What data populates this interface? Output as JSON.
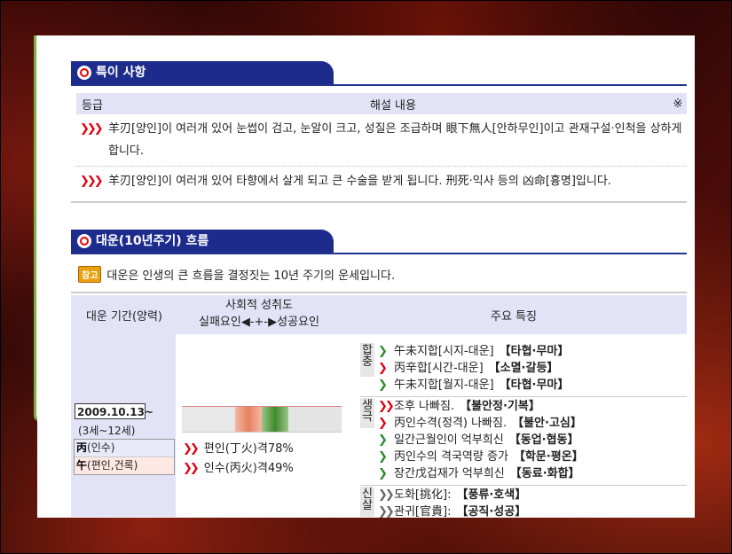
{
  "special_section": {
    "title": "특이 사항",
    "header": {
      "grade": "등급",
      "content": "해설 내용",
      "mark": "※"
    },
    "rows": [
      {
        "text": "羊刃[양인]이 여러개 있어 눈썹이 검고, 눈알이 크고, 성질은 조급하며 眼下無人[안하무인]이고 관재구설·인척을 상하게 합니다."
      },
      {
        "text": "羊刃[양인]이 여러개 있어 타향에서 살게 되고 큰 수술을 받게 됩니다. 刑死·익사 등의 凶命[흉명]입니다."
      }
    ]
  },
  "luck_section": {
    "title": "대운(10년주기) 흐름",
    "note_badge": "참고",
    "note_text": "대운은 인생의 큰 흐름을 결정짓는 10년 주기의 운세입니다.",
    "table_header": {
      "period": "대운 기간(양력)",
      "social_line1": "사회적 성취도",
      "social_line2": "실패요인◀-+-▶성공요인",
      "features": "주요 특징"
    },
    "period": {
      "date": "2009.10.13~",
      "age": "(3세~12세)",
      "stem_char": "丙",
      "stem_desc": "(인수)",
      "branch_char": "午",
      "branch_desc": "(편인,건록)"
    },
    "stats": [
      {
        "label": "편인(丁火)격78%"
      },
      {
        "label": "인수(丙火)격49%"
      }
    ],
    "groups": [
      {
        "label": "합충",
        "items": [
          {
            "icon": "green",
            "text": "午未지합[시지-대운]",
            "tag": "【타협·무마】"
          },
          {
            "icon": "red",
            "text": "丙辛합[시간-대운]",
            "tag": "【소멸·갈등】"
          },
          {
            "icon": "green",
            "text": "午未지합[월지-대운]",
            "tag": "【타협·무마】"
          }
        ]
      },
      {
        "label": "생극",
        "items": [
          {
            "icon": "red",
            "text": "조후 나빠짐.",
            "tag": "【불안정·기복】"
          },
          {
            "icon": "red",
            "text": "丙인수격(정격) 나빠짐.",
            "tag": "【불안·고심】"
          },
          {
            "icon": "green",
            "text": "일간근월인이 억부희신",
            "tag": "【동업·협동】"
          },
          {
            "icon": "green",
            "text": "丙인수의 격국역량 증가",
            "tag": "【학문·평온】"
          },
          {
            "icon": "green",
            "text": "장간戊겁재가 억부희신",
            "tag": "【동료·화합】"
          }
        ]
      },
      {
        "label": "신살",
        "items": [
          {
            "icon": "gray",
            "text": "도화[挑化]:",
            "tag": "【풍류·호색】"
          },
          {
            "icon": "gray",
            "text": "관귀[官貴]:",
            "tag": "【공직·성공】"
          }
        ]
      }
    ]
  },
  "colors": {
    "accent": "#1d2c8c",
    "highlight": "#e00010",
    "positive": "#2a8a2a",
    "header_bg": "#e2e3f7"
  }
}
